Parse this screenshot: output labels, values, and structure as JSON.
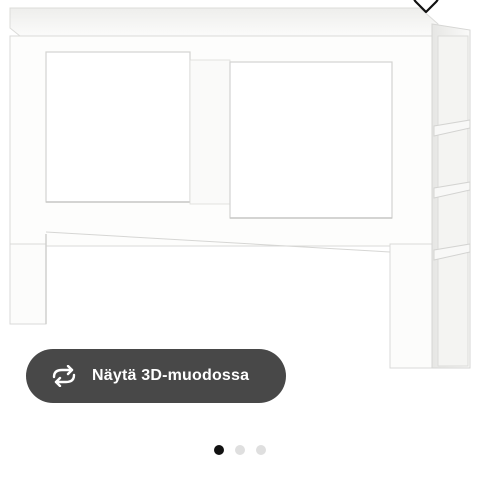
{
  "view_3d_button": {
    "label": "Näytä 3D-muodossa"
  },
  "carousel": {
    "slide_count": 3,
    "active_index": 0
  },
  "icons": {
    "view_3d": "rotate-arrows-icon",
    "wishlist": "heart-icon"
  },
  "colors": {
    "button_background": "#484848",
    "button_text": "#ffffff",
    "dot_active": "#111111",
    "dot_inactive": "#dfdfdf"
  }
}
